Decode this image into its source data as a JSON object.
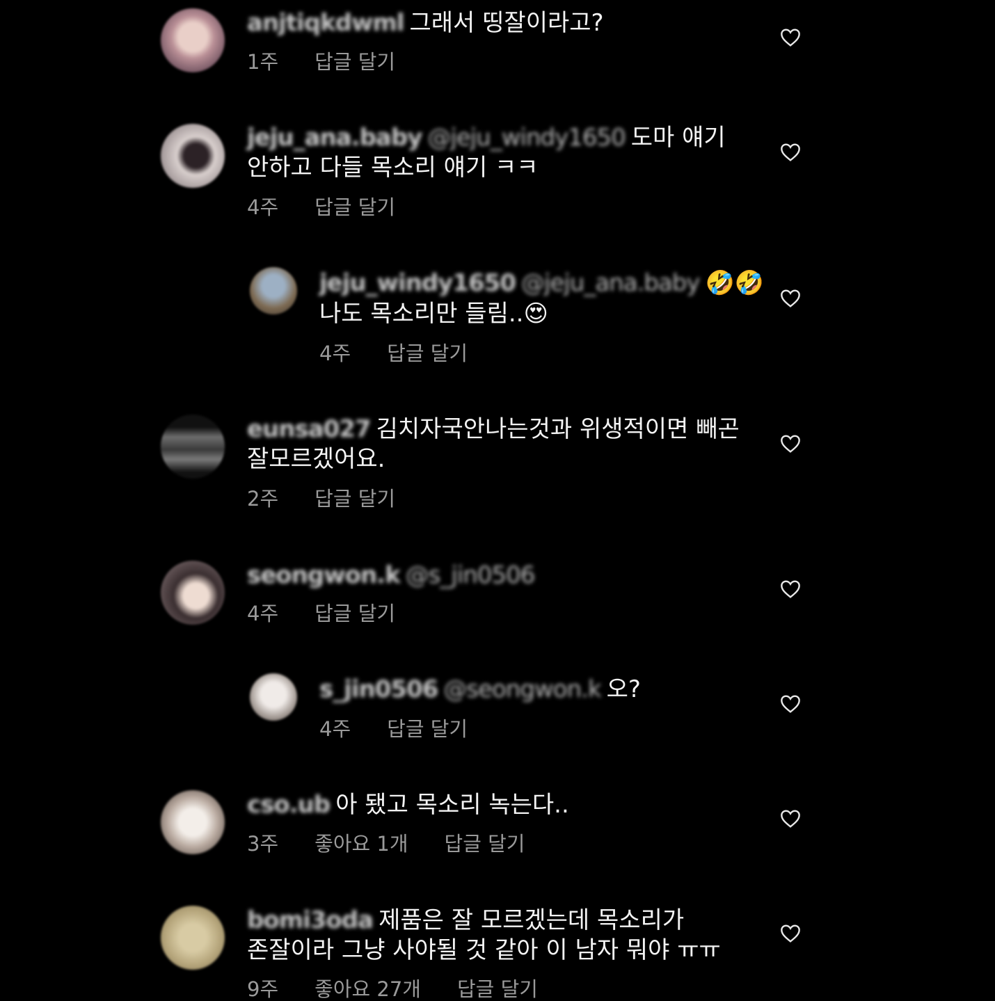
{
  "comments": [
    {
      "username": "anjtiqkdwml",
      "mention": "",
      "text_line1": "그래서 띵잘이라고?",
      "text_line2": "",
      "time": "1주",
      "likes": "",
      "reply_label": "답글 달기",
      "avatar_colors": [
        "#c9a3a0",
        "#7a5a66"
      ]
    },
    {
      "username": "jeju_ana.baby",
      "mention": "@jeju_windy1650",
      "text_line1": "도마 얘기",
      "text_line2": "안하고 다들 목소리 얘기 ㅋㅋ",
      "time": "4주",
      "likes": "",
      "reply_label": "답글 달기",
      "avatar_colors": [
        "#d9d2d0",
        "#3a3034"
      ]
    },
    {
      "username": "jeju_windy1650",
      "mention": "@jeju_ana.baby",
      "text_line1": "🤣🤣",
      "text_line2": "나도 목소리만 들림..😍",
      "time": "4주",
      "likes": "",
      "reply_label": "답글 달기",
      "avatar_colors": [
        "#8ea2b8",
        "#6b5a44"
      ]
    },
    {
      "username": "eunsa027",
      "mention": "",
      "text_line1": "김치자국안나는것과 위생적이면 빼곤",
      "text_line2": "잘모르겠어요.",
      "time": "2주",
      "likes": "",
      "reply_label": "답글 달기",
      "avatar_colors": [
        "#6a6a6a",
        "#1e1e1e"
      ]
    },
    {
      "username": "seongwon.k",
      "mention": "@s_jin0506",
      "text_line1": "",
      "text_line2": "",
      "time": "4주",
      "likes": "",
      "reply_label": "답글 달기",
      "avatar_colors": [
        "#e8d8cf",
        "#2a2224"
      ]
    },
    {
      "username": "s_jin0506",
      "mention": "@seongwon.k",
      "text_line1": "오?",
      "text_line2": "",
      "time": "4주",
      "likes": "",
      "reply_label": "답글 달기",
      "avatar_colors": [
        "#e6e0dc",
        "#8d8580"
      ]
    },
    {
      "username": "cso.ub",
      "mention": "",
      "text_line1": "아 됐고 목소리 녹는다..",
      "text_line2": "",
      "time": "3주",
      "likes": "좋아요 1개",
      "reply_label": "답글 달기",
      "avatar_colors": [
        "#ece6e2",
        "#7b6e66"
      ]
    },
    {
      "username": "bomi3oda",
      "mention": "",
      "text_line1": "제품은 잘 모르겠는데 목소리가",
      "text_line2": "존잘이라 그냥 사야될 것 같아 이 남자 뭐야 ㅠㅠ",
      "time": "9주",
      "likes": "좋아요 27개",
      "reply_label": "답글 달기",
      "avatar_colors": [
        "#cbbd96",
        "#9a8a63"
      ]
    }
  ],
  "icons": {
    "like": "heart-outline-icon"
  },
  "colors": {
    "background": "#000000",
    "text": "#f3f3f3",
    "meta": "#9a9a9a"
  }
}
